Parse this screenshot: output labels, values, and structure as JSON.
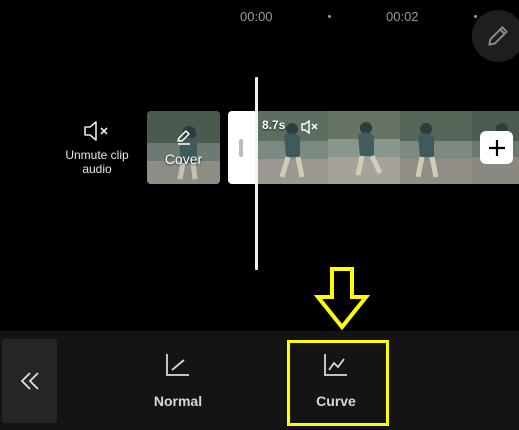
{
  "timeline": {
    "timecodes": [
      "00:00",
      "00:02"
    ]
  },
  "track": {
    "mute_label": "Unmute clip audio",
    "cover_label": "Cover",
    "clip_duration": "8.7s"
  },
  "bottom": {
    "options": [
      {
        "label": "Normal",
        "icon": "normal-speed-icon"
      },
      {
        "label": "Curve",
        "icon": "curve-speed-icon"
      }
    ]
  },
  "annotation": {
    "highlight_color": "#ffff00"
  }
}
